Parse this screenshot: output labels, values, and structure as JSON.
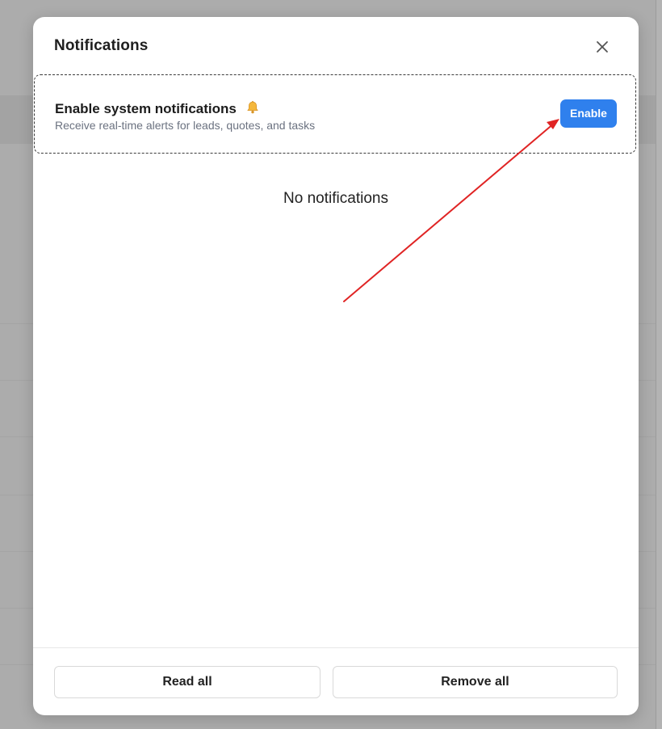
{
  "modal": {
    "title": "Notifications",
    "close_icon": "close-icon"
  },
  "banner": {
    "title": "Enable system notifications",
    "icon": "bell-icon",
    "description": "Receive real-time alerts for leads, quotes, and tasks",
    "button_label": "Enable"
  },
  "empty_state": {
    "text": "No notifications"
  },
  "footer": {
    "read_all_label": "Read all",
    "remove_all_label": "Remove all"
  },
  "colors": {
    "accent": "#2f80ed",
    "annotation": "#e02424",
    "backdrop": "#acacac"
  }
}
